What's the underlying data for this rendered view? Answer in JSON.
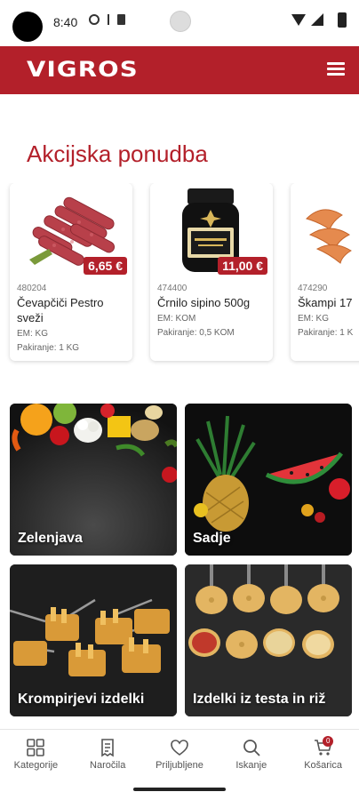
{
  "status_bar": {
    "time": "8:40"
  },
  "header": {
    "logo": "VIGROS",
    "brand_color": "#b3202a"
  },
  "promo": {
    "title": "Akcijska ponudba",
    "products": [
      {
        "code": "480204",
        "name": "Čevapčiči Pestro sveži",
        "em": "EM: KG",
        "pack": "Pakiranje: 1 KG",
        "price": "6,65 €"
      },
      {
        "code": "474400",
        "name": "Črnilo sipino 500g",
        "em": "EM: KOM",
        "pack": "Pakiranje: 0,5 KOM",
        "price": "11,00 €"
      },
      {
        "code": "474290",
        "name": "Škampi 17",
        "em": "EM: KG",
        "pack": "Pakiranje: 1 K",
        "price": ""
      }
    ]
  },
  "categories": [
    {
      "label": "Zelenjava"
    },
    {
      "label": "Sadje"
    },
    {
      "label": "Krompirjevi izdelki"
    },
    {
      "label": "Izdelki iz testa in riž"
    }
  ],
  "bottom_nav": {
    "items": [
      {
        "label": "Kategorije",
        "icon": "grid-icon"
      },
      {
        "label": "Naročila",
        "icon": "receipt-icon"
      },
      {
        "label": "Priljubljene",
        "icon": "heart-icon"
      },
      {
        "label": "Iskanje",
        "icon": "search-icon"
      },
      {
        "label": "Košarica",
        "icon": "cart-icon"
      }
    ],
    "cart_count": "0"
  }
}
